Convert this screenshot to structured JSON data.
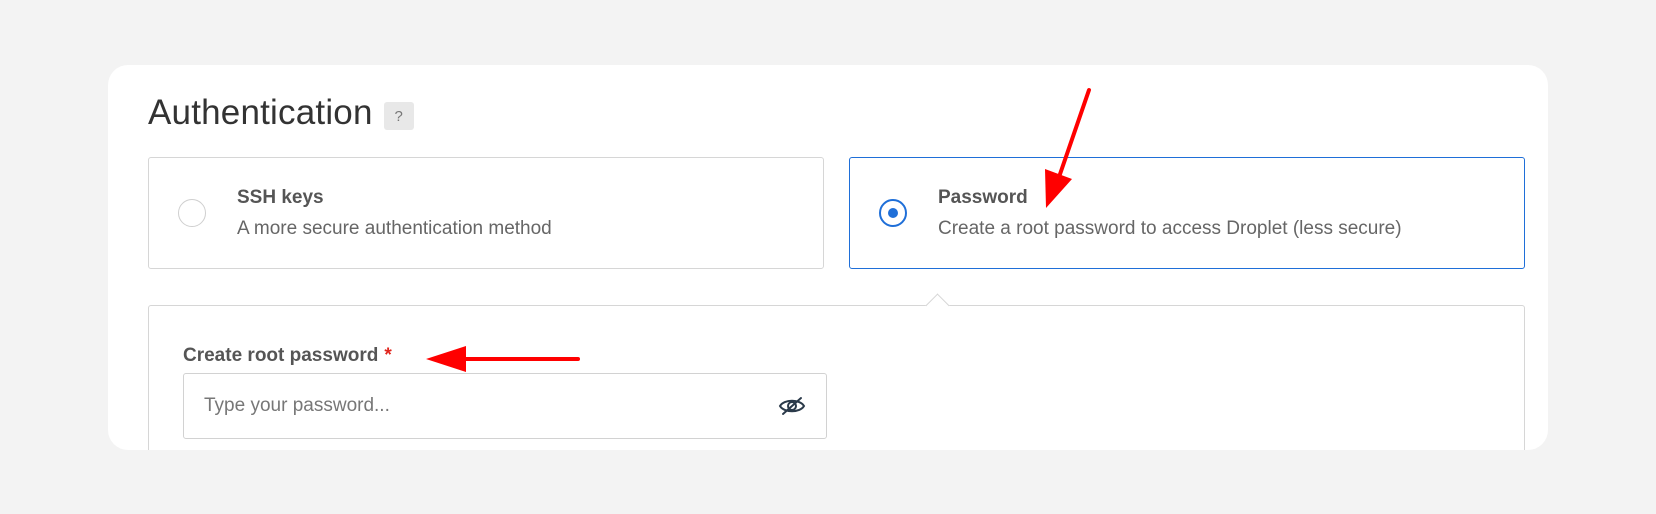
{
  "authentication": {
    "title": "Authentication",
    "help_label": "?",
    "options": [
      {
        "title": "SSH keys",
        "description": "A more secure authentication method",
        "selected": false
      },
      {
        "title": "Password",
        "description": "Create a root password to access Droplet (less secure)",
        "selected": true
      }
    ],
    "password_field": {
      "label": "Create root password",
      "required_marker": "*",
      "placeholder": "Type your password...",
      "value": "",
      "toggle_icon": "eye-slash-icon"
    }
  },
  "annotations": {
    "arrow_color": "#ff0000"
  },
  "colors": {
    "accent": "#1f6fd8",
    "required": "#e0241c"
  }
}
